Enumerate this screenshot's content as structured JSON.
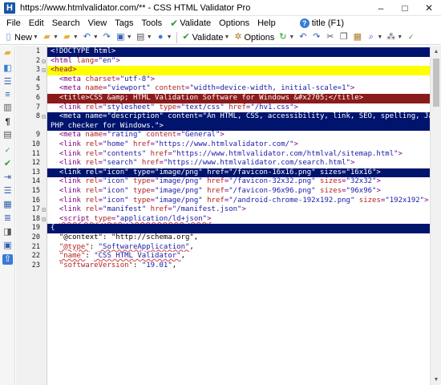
{
  "window": {
    "title": "https://www.htmlvalidator.com/** - CSS HTML Validator Pro",
    "logo_letter": "H",
    "minimize": "–",
    "maximize": "□",
    "close": "✕"
  },
  "menu": {
    "file": "File",
    "edit": "Edit",
    "search": "Search",
    "view": "View",
    "tags": "Tags",
    "tools": "Tools",
    "validate": "Validate",
    "options": "Options",
    "help": "Help",
    "title_help": "title (F1)"
  },
  "toolbar": {
    "new_label": "New",
    "validate_label": "Validate",
    "options_label": "Options"
  },
  "editor": {
    "lines": [
      {
        "n": "1",
        "segs": [
          [
            "k",
            "<!DOCTYPE html>"
          ]
        ]
      },
      {
        "n": "2",
        "segs": [
          [
            "t",
            "<html "
          ],
          [
            "a",
            "lang"
          ],
          [
            "t",
            "="
          ],
          [
            "v",
            "\"en\""
          ],
          [
            "t",
            ">"
          ]
        ]
      },
      {
        "n": "3",
        "segs": [
          [
            "t",
            "<head>"
          ]
        ]
      },
      {
        "n": "4",
        "segs": [
          [
            "k",
            "  "
          ],
          [
            "t",
            "<meta "
          ],
          [
            "a",
            "charset"
          ],
          [
            "t",
            "="
          ],
          [
            "v",
            "\"utf-8\""
          ],
          [
            "t",
            ">"
          ]
        ]
      },
      {
        "n": "5",
        "segs": [
          [
            "k",
            "  "
          ],
          [
            "t",
            "<meta "
          ],
          [
            "a",
            "name"
          ],
          [
            "t",
            "="
          ],
          [
            "v",
            "\"viewport\""
          ],
          [
            "t",
            " "
          ],
          [
            "a",
            "content"
          ],
          [
            "t",
            "="
          ],
          [
            "v",
            "\"width=device-width, initial-scale=1\""
          ],
          [
            "t",
            ">"
          ]
        ]
      },
      {
        "n": "6",
        "segs": [
          [
            "k",
            "  <title>CSS &amp; HTML Validation Software for Windows &#x2705;</title>"
          ]
        ]
      },
      {
        "n": "7",
        "segs": [
          [
            "k",
            "  "
          ],
          [
            "t",
            "<link "
          ],
          [
            "a",
            "rel"
          ],
          [
            "t",
            "="
          ],
          [
            "v",
            "\"stylesheet\""
          ],
          [
            "t",
            " "
          ],
          [
            "a",
            "type"
          ],
          [
            "t",
            "="
          ],
          [
            "v",
            "\"text/css\""
          ],
          [
            "t",
            " "
          ],
          [
            "a",
            "href"
          ],
          [
            "t",
            "="
          ],
          [
            "v",
            "\"/hv1.css\""
          ],
          [
            "t",
            ">"
          ]
        ]
      },
      {
        "n": "8",
        "segs": [
          [
            "k",
            "  <meta name=\"description\" content=\"An HTML, CSS, accessibility, link, SEO, spelling, JavaScript, and ¬"
          ]
        ]
      },
      {
        "n": "",
        "segs": [
          [
            "k",
            "PHP checker for Windows.\">"
          ]
        ]
      },
      {
        "n": "9",
        "segs": [
          [
            "k",
            "  "
          ],
          [
            "t",
            "<meta "
          ],
          [
            "a",
            "name"
          ],
          [
            "t",
            "="
          ],
          [
            "v",
            "\"rating\""
          ],
          [
            "t",
            " "
          ],
          [
            "a",
            "content"
          ],
          [
            "t",
            "="
          ],
          [
            "v",
            "\"General\""
          ],
          [
            "t",
            ">"
          ]
        ]
      },
      {
        "n": "10",
        "segs": [
          [
            "k",
            "  "
          ],
          [
            "t",
            "<link "
          ],
          [
            "a",
            "rel"
          ],
          [
            "t",
            "="
          ],
          [
            "v",
            "\"home\""
          ],
          [
            "t",
            " "
          ],
          [
            "a",
            "href"
          ],
          [
            "t",
            "="
          ],
          [
            "v",
            "\"https://www.htmlvalidator.com/\""
          ],
          [
            "t",
            ">"
          ]
        ]
      },
      {
        "n": "11",
        "segs": [
          [
            "k",
            "  "
          ],
          [
            "t",
            "<link "
          ],
          [
            "a",
            "rel"
          ],
          [
            "t",
            "="
          ],
          [
            "v",
            "\"contents\""
          ],
          [
            "t",
            " "
          ],
          [
            "a",
            "href"
          ],
          [
            "t",
            "="
          ],
          [
            "v",
            "\"https://www.htmlvalidator.com/htmlval/sitemap.html\""
          ],
          [
            "t",
            ">"
          ]
        ]
      },
      {
        "n": "12",
        "segs": [
          [
            "k",
            "  "
          ],
          [
            "t",
            "<link "
          ],
          [
            "a",
            "rel"
          ],
          [
            "t",
            "="
          ],
          [
            "v",
            "\"search\""
          ],
          [
            "t",
            " "
          ],
          [
            "a",
            "href"
          ],
          [
            "t",
            "="
          ],
          [
            "v",
            "\"https://www.htmlvalidator.com/search.html\""
          ],
          [
            "t",
            ">"
          ]
        ]
      },
      {
        "n": "13",
        "segs": [
          [
            "k",
            "  <link rel=\"icon\" type=\"image/png\" href=\"/favicon-16x16.png\" sizes=\"16x16\">"
          ]
        ]
      },
      {
        "n": "14",
        "segs": [
          [
            "k",
            "  "
          ],
          [
            "t",
            "<link "
          ],
          [
            "a",
            "rel"
          ],
          [
            "t",
            "="
          ],
          [
            "v",
            "\"icon\""
          ],
          [
            "t",
            " "
          ],
          [
            "a",
            "type"
          ],
          [
            "t",
            "="
          ],
          [
            "v",
            "\"image/png\""
          ],
          [
            "t",
            " "
          ],
          [
            "a",
            "href"
          ],
          [
            "t",
            "="
          ],
          [
            "v",
            "\"/favicon-32x32.png\""
          ],
          [
            "t",
            " "
          ],
          [
            "a",
            "sizes"
          ],
          [
            "t",
            "="
          ],
          [
            "v",
            "\"32x32\""
          ],
          [
            "t",
            ">"
          ]
        ]
      },
      {
        "n": "15",
        "segs": [
          [
            "k",
            "  "
          ],
          [
            "t",
            "<link "
          ],
          [
            "a",
            "rel"
          ],
          [
            "t",
            "="
          ],
          [
            "v",
            "\"icon\""
          ],
          [
            "t",
            " "
          ],
          [
            "a",
            "type"
          ],
          [
            "t",
            "="
          ],
          [
            "v",
            "\"image/png\""
          ],
          [
            "t",
            " "
          ],
          [
            "a",
            "href"
          ],
          [
            "t",
            "="
          ],
          [
            "v",
            "\"/favicon-96x96.png\""
          ],
          [
            "t",
            " "
          ],
          [
            "a",
            "sizes"
          ],
          [
            "t",
            "="
          ],
          [
            "v",
            "\"96x96\""
          ],
          [
            "t",
            ">"
          ]
        ]
      },
      {
        "n": "16",
        "segs": [
          [
            "k",
            "  "
          ],
          [
            "t",
            "<link "
          ],
          [
            "a",
            "rel"
          ],
          [
            "t",
            "="
          ],
          [
            "v",
            "\"icon\""
          ],
          [
            "t",
            " "
          ],
          [
            "a",
            "type"
          ],
          [
            "t",
            "="
          ],
          [
            "v",
            "\"image/png\""
          ],
          [
            "t",
            " "
          ],
          [
            "a",
            "href"
          ],
          [
            "t",
            "="
          ],
          [
            "v",
            "\"/android-chrome-192x192.png\""
          ],
          [
            "t",
            " "
          ],
          [
            "a",
            "sizes"
          ],
          [
            "t",
            "="
          ],
          [
            "v",
            "\"192x192\""
          ],
          [
            "t",
            ">"
          ]
        ]
      },
      {
        "n": "17",
        "segs": [
          [
            "k",
            "  "
          ],
          [
            "t",
            "<link "
          ],
          [
            "a",
            "rel"
          ],
          [
            "t",
            "="
          ],
          [
            "v",
            "\"manifest\""
          ],
          [
            "t",
            " "
          ],
          [
            "a",
            "href"
          ],
          [
            "t",
            "="
          ],
          [
            "v",
            "\"/manifest.json\""
          ],
          [
            "t",
            ">"
          ]
        ]
      },
      {
        "n": "18",
        "segs": [
          [
            "k",
            "  "
          ],
          [
            "t",
            "<script "
          ],
          [
            "a",
            "type"
          ],
          [
            "t",
            "="
          ],
          [
            "v",
            "\"application/ld+json\""
          ],
          [
            "t",
            ">"
          ]
        ]
      },
      {
        "n": "19",
        "segs": [
          [
            "k",
            "{"
          ]
        ]
      },
      {
        "n": "20",
        "segs": [
          [
            "k",
            "  \"@context\": \"http://schema.org\","
          ]
        ]
      },
      {
        "n": "21",
        "segs": [
          [
            "k",
            "  "
          ],
          [
            "s",
            "\"@type\""
          ],
          [
            "k",
            ": "
          ],
          [
            "v",
            "\"SoftwareApplication\""
          ],
          [
            "k",
            ","
          ]
        ]
      },
      {
        "n": "22",
        "segs": [
          [
            "k",
            "  "
          ],
          [
            "s",
            "\"name\""
          ],
          [
            "k",
            ": "
          ],
          [
            "v",
            "\"CSS HTML Validator\""
          ],
          [
            "k",
            ","
          ]
        ]
      },
      {
        "n": "23",
        "segs": [
          [
            "k",
            "  "
          ],
          [
            "s",
            "\"softwareVersion\""
          ],
          [
            "k",
            ": "
          ],
          [
            "v",
            "\"19.01\""
          ],
          [
            "k",
            ","
          ]
        ]
      }
    ]
  }
}
